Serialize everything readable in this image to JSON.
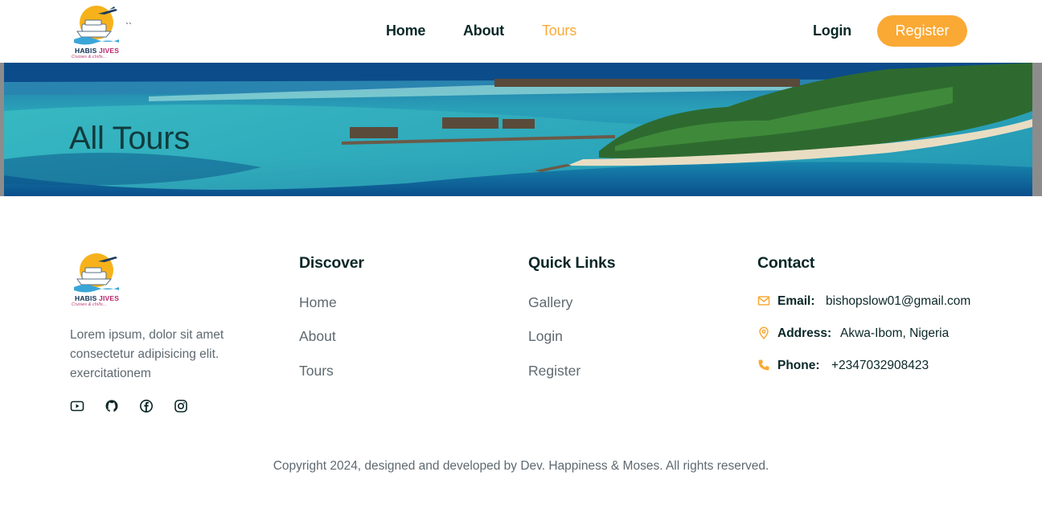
{
  "brand": {
    "name_part1": "HABIS ",
    "name_part2": "JIVES",
    "tagline": "Cruises & chills...",
    "ticks": "``"
  },
  "nav": {
    "home": "Home",
    "about": "About",
    "tours": "Tours"
  },
  "auth": {
    "login": "Login",
    "register": "Register"
  },
  "hero": {
    "title": "All Tours"
  },
  "footer": {
    "about_text": "Lorem ipsum, dolor sit amet consectetur adipisicing elit. exercitationem",
    "socials": [
      "youtube-icon",
      "github-icon",
      "facebook-icon",
      "instagram-icon"
    ],
    "discover": {
      "title": "Discover",
      "links": [
        "Home",
        "About",
        "Tours"
      ]
    },
    "quick_links": {
      "title": "Quick Links",
      "links": [
        "Gallery",
        "Login",
        "Register"
      ]
    },
    "contact": {
      "title": "Contact",
      "email_label": "Email:",
      "email": "bishopslow01@gmail.com",
      "address_label": "Address:",
      "address": "Akwa-Ibom, Nigeria",
      "phone_label": "Phone:",
      "phone": "+2347032908423"
    },
    "copyright": "Copyright 2024, designed and developed by Dev. Happiness & Moses. All rights reserved."
  },
  "colors": {
    "accent": "#faa935",
    "heading": "#0b2727",
    "text": "#5e6970"
  }
}
